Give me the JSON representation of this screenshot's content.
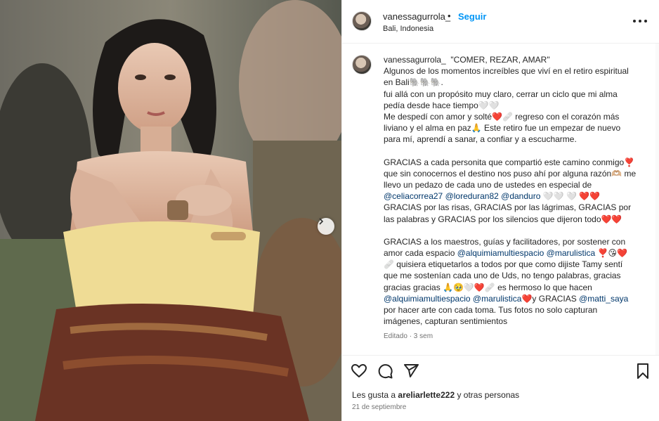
{
  "post": {
    "username": "vanessagurrola_",
    "separator": "•",
    "follow_label": "Seguir",
    "location": "Bali, Indonesia",
    "more_icon": "more-horizontal-icon"
  },
  "caption": {
    "username": "vanessagurrola_",
    "lines": [
      "\"COMER, REZAR, AMAR\"",
      "Algunos de los momentos increíbles que viví en el retiro espiritual en Bali🐘🐘🐘.",
      "fui allá con un propósito muy claro, cerrar un ciclo que mi alma pedía desde hace tiempo🤍🤍",
      "Me despedí con amor y solté❤️🩹 regreso con el corazón más liviano y el alma en paz🙏 Este retiro fue un empezar de nuevo para mí, aprendí a sanar, a confiar y a escucharme."
    ],
    "p2_start": "GRACIAS a cada personita que compartió este camino conmigo❣️que sin conocernos el destino nos puso ahí por alguna razón🫶🏼 me llevo un pedazo de cada uno de ustedes en especial de ",
    "p2_mentions": [
      "@celiacorrea27",
      "@loreduran82",
      "@danduro"
    ],
    "p2_end": " 🤍🤍 🤍 ❤️❤️",
    "p3": "GRACIAS por las risas, GRACIAS por las lágrimas, GRACIAS por las palabras y GRACIAS por los silencios que dijeron todo❤️❤️",
    "p4_start": "GRACIAS a los maestros, guías y facilitadores, por sostener con amor cada espacio ",
    "p4_mention1": "@alquimiamultiespacio",
    "p4_mention2": "@marulistica",
    "p4_mid": " ❣️😘❤️🩹 quisiera etiquetarlos a todos por que como dijiste Tamy sentí que me sostenían cada uno de Uds, no tengo palabras, gracias gracias gracias 🙏🥹🤍❤️🩹 es hermoso lo que hacen ",
    "p4_mention3": "@alquimiamultiespacio",
    "p4_mention4": "@marulistica",
    "p4_mid2": "❤️y GRACIAS ",
    "p4_mention5": "@matti_saya",
    "p4_end": " por hacer arte con cada toma. Tus fotos no solo capturan imágenes, capturan sentimientos",
    "meta": "Editado · 3 sem"
  },
  "actions": {
    "like_icon": "heart-icon",
    "comment_icon": "comment-icon",
    "share_icon": "share-icon",
    "save_icon": "bookmark-icon",
    "likes_prefix": "Les gusta a ",
    "likes_user": "areliarlette222",
    "likes_suffix": " y otras personas",
    "date": "21 de septiembre"
  },
  "colors": {
    "link": "#00376b",
    "follow": "#0095f6",
    "heart": "#d11a2a"
  }
}
